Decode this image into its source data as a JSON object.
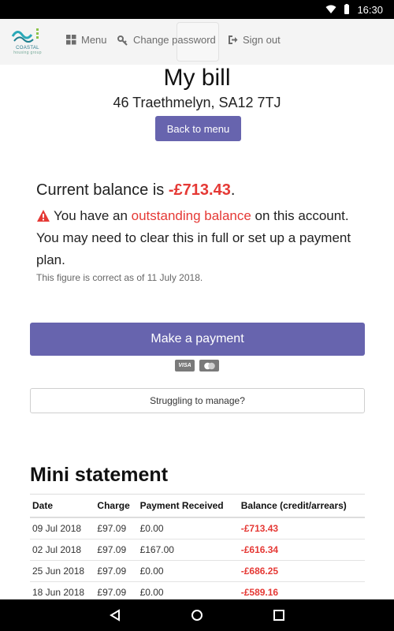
{
  "status_bar": {
    "time": "16:30"
  },
  "nav": {
    "logo_text": "COASTAL",
    "logo_sub": "housing group",
    "menu_label": "Menu",
    "change_password_label": "Change password",
    "sign_out_label": "Sign out"
  },
  "page": {
    "title": "My bill",
    "address": "46 Traethmelyn, SA12 7TJ",
    "back_button": "Back to menu"
  },
  "balance": {
    "prefix": "Current balance is ",
    "amount": "-£713.43",
    "suffix": ".",
    "warning_pre": "You have an ",
    "warning_hl": "outstanding balance",
    "warning_post": " on this account. You may need to clear this in full or set up a payment plan.",
    "as_of": "This figure is correct as of 11 July 2018."
  },
  "payment": {
    "make_payment": "Make a payment",
    "card_visa": "VISA",
    "struggling": "Struggling to manage?"
  },
  "statement": {
    "title": "Mini statement",
    "headers": [
      "Date",
      "Charge",
      "Payment Received",
      "Balance (credit/arrears)"
    ],
    "rows": [
      [
        "09 Jul 2018",
        "£97.09",
        "£0.00",
        "-£713.43"
      ],
      [
        "02 Jul 2018",
        "£97.09",
        "£167.00",
        "-£616.34"
      ],
      [
        "25 Jun 2018",
        "£97.09",
        "£0.00",
        "-£686.25"
      ],
      [
        "18 Jun 2018",
        "£97.09",
        "£0.00",
        "-£589.16"
      ]
    ]
  },
  "colors": {
    "accent": "#6764ae",
    "negative": "#e53935"
  }
}
